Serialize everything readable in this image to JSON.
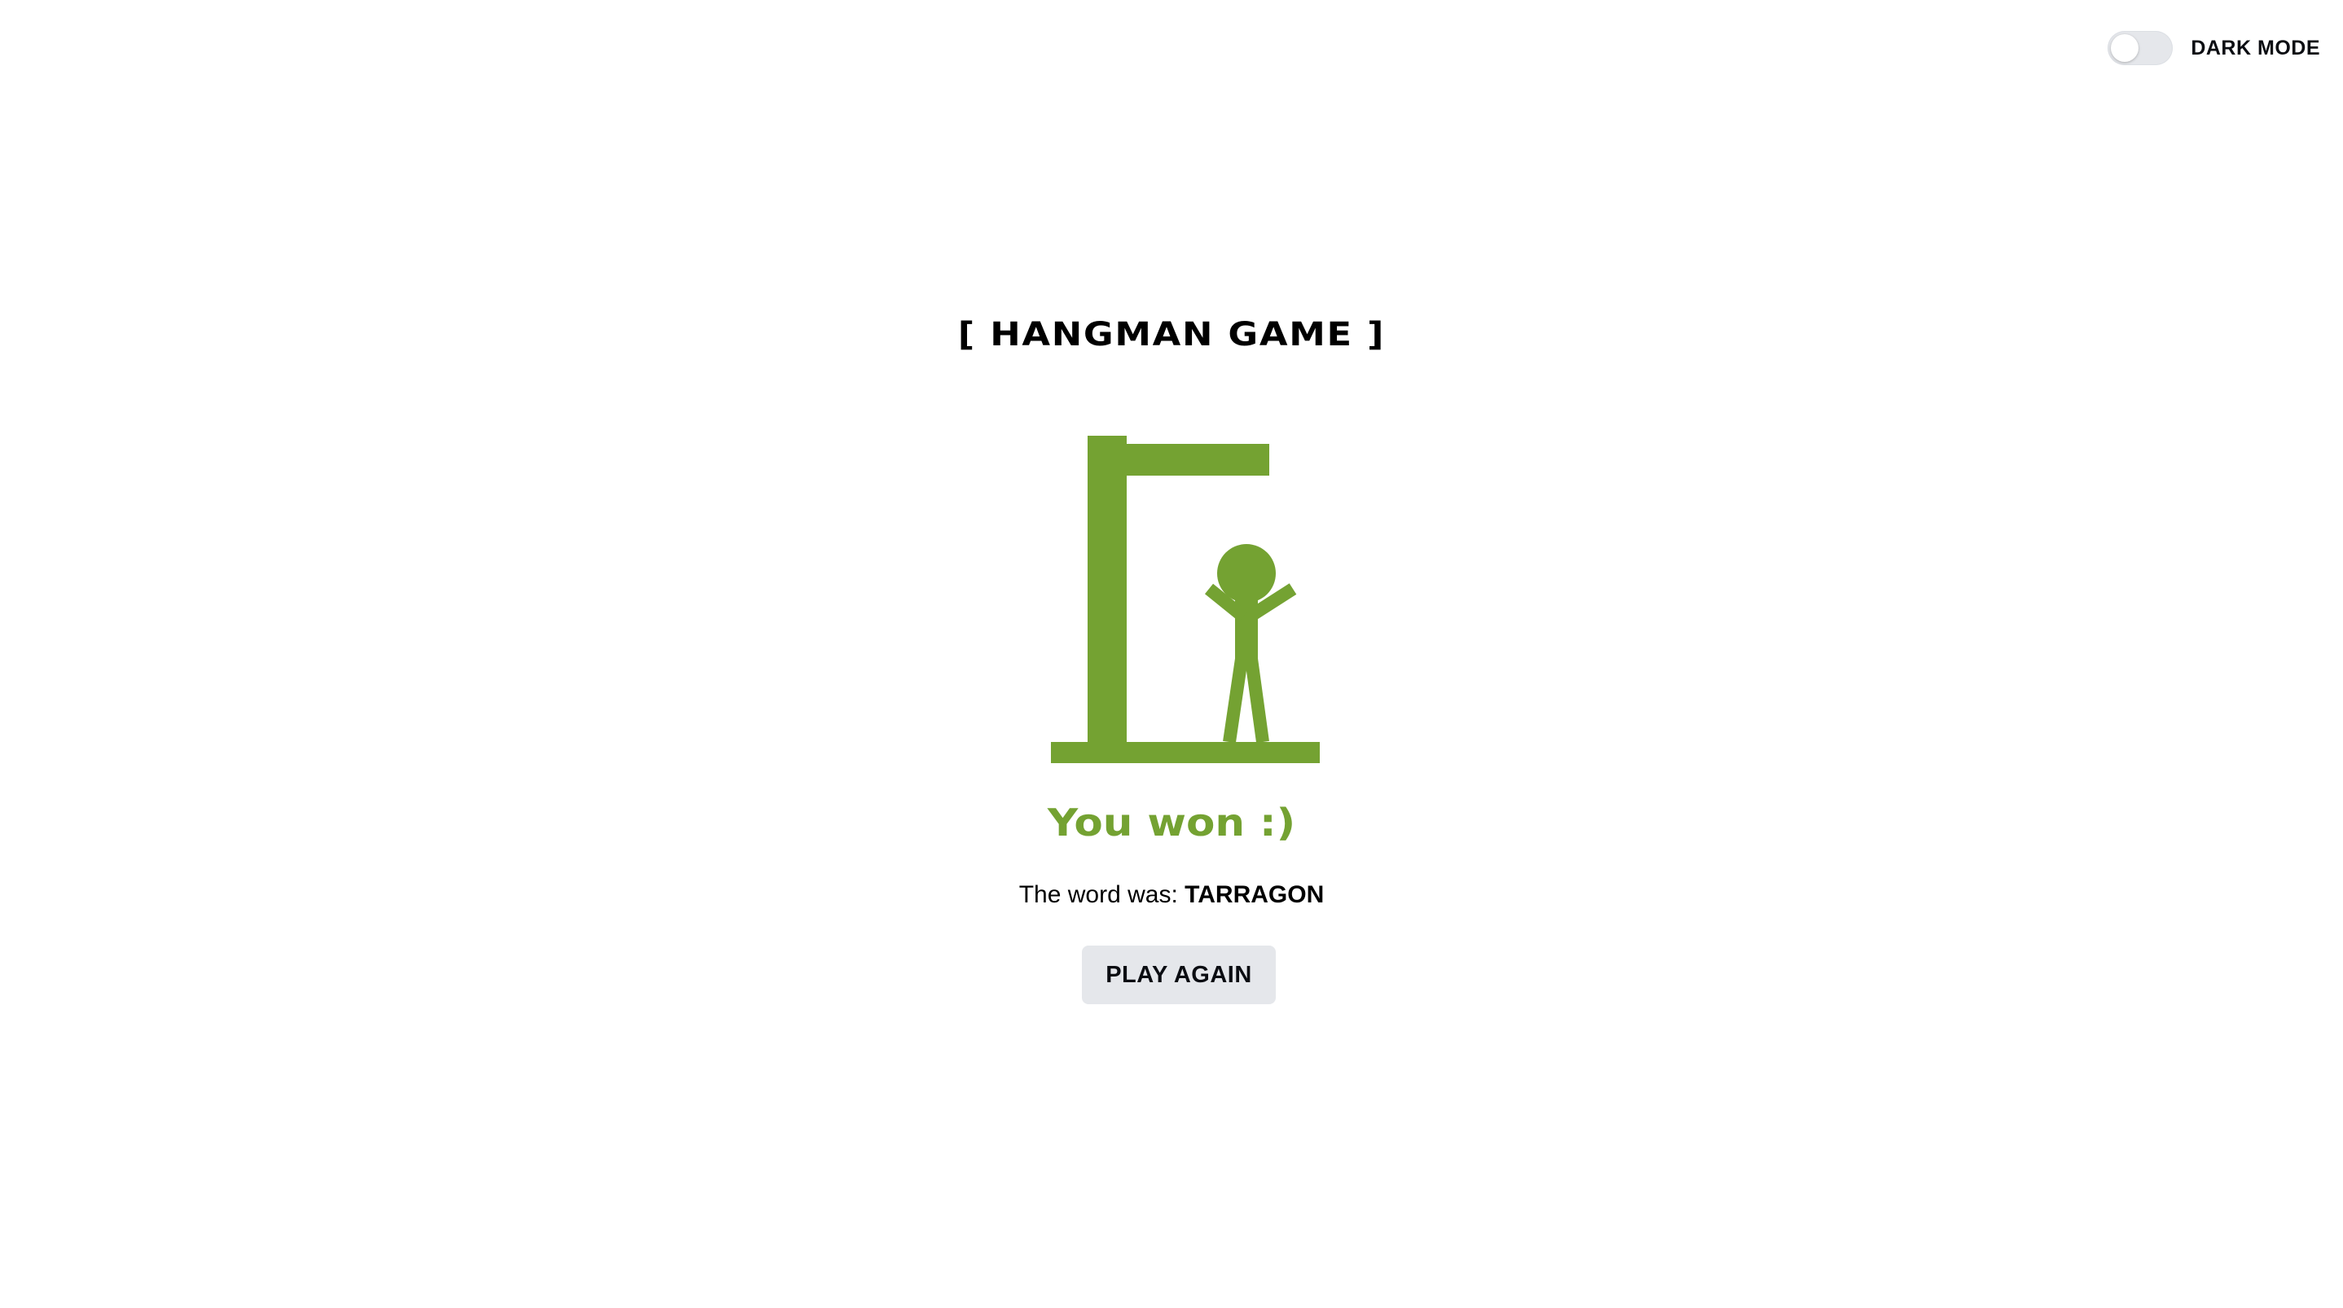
{
  "header": {
    "dark_mode_label": "DARK MODE",
    "dark_mode_on": false
  },
  "game": {
    "title": "[ HANGMAN GAME ]",
    "result_message": "You won :)",
    "word_prefix": "The word was:",
    "word": "TARRAGON",
    "play_again_label": "PLAY AGAIN"
  },
  "colors": {
    "accent": "#74a232",
    "button_bg": "#e5e7eb",
    "toggle_bg": "#e5e7eb"
  }
}
